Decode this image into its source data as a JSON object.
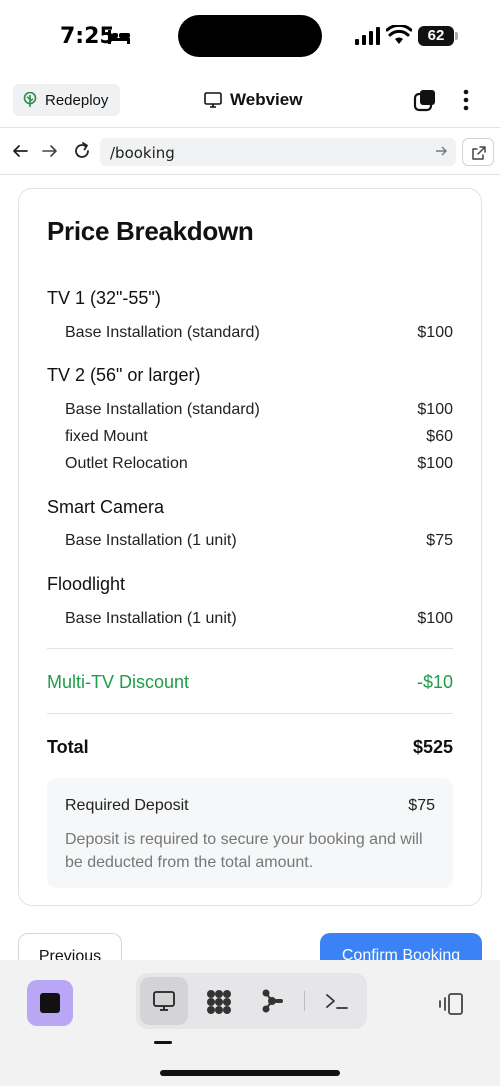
{
  "status": {
    "time": "7:25",
    "battery": "62"
  },
  "toolbar": {
    "redeploy_label": "Redeploy",
    "title": "Webview"
  },
  "browser": {
    "url": "/booking"
  },
  "breakdown": {
    "title": "Price Breakdown",
    "groups": [
      {
        "name": "TV 1 (32\"-55\")",
        "items": [
          {
            "label": "Base Installation (standard)",
            "price": "$100"
          }
        ]
      },
      {
        "name": "TV 2 (56\" or larger)",
        "items": [
          {
            "label": "Base Installation (standard)",
            "price": "$100"
          },
          {
            "label": "fixed Mount",
            "price": "$60"
          },
          {
            "label": "Outlet Relocation",
            "price": "$100"
          }
        ]
      },
      {
        "name": "Smart Camera",
        "items": [
          {
            "label": "Base Installation (1 unit)",
            "price": "$75"
          }
        ]
      },
      {
        "name": "Floodlight",
        "items": [
          {
            "label": "Base Installation (1 unit)",
            "price": "$100"
          }
        ]
      }
    ],
    "discount": {
      "label": "Multi-TV Discount",
      "value": "-$10"
    },
    "total": {
      "label": "Total",
      "value": "$525"
    },
    "deposit": {
      "label": "Required Deposit",
      "value": "$75",
      "note": "Deposit is required to secure your booking and will be deducted from the total amount."
    }
  },
  "actions": {
    "previous_label": "Previous",
    "confirm_label": "Confirm Booking"
  },
  "colors": {
    "accent": "#3b82f6",
    "discount": "#1f9d4a",
    "app_icon": "#b9a6f5"
  },
  "bottom_tabs": [
    "monitor-icon",
    "grid-icon",
    "share-nodes-icon",
    "terminal-icon"
  ]
}
